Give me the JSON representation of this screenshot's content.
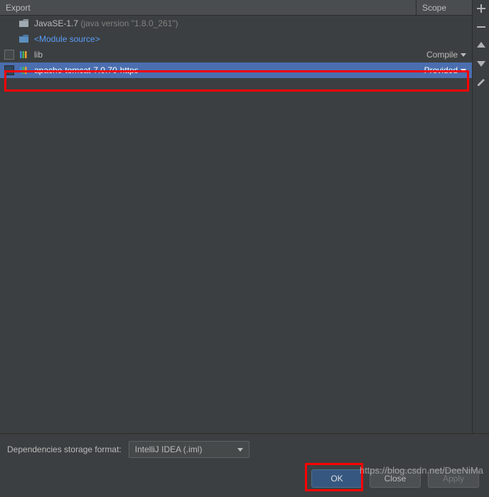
{
  "header": {
    "export": "Export",
    "scope": "Scope"
  },
  "rows": {
    "java": {
      "label": "JavaSE-1.7",
      "detail": " (java version \"1.8.0_261\")"
    },
    "module": {
      "label": "<Module source>"
    },
    "lib": {
      "label": "lib",
      "scope": "Compile"
    },
    "tomcat": {
      "label": "apache-tomcat-7.0.70-https",
      "scope": "Provided"
    }
  },
  "sidebar": {
    "add": "+",
    "remove": "−",
    "up": "▲",
    "down": "▼",
    "edit": "✎"
  },
  "storage": {
    "label": "Dependencies storage format:",
    "value": "IntelliJ IDEA (.iml)"
  },
  "buttons": {
    "ok": "OK",
    "close": "Close",
    "apply": "Apply"
  },
  "watermark": "https://blog.csdn.net/DeeNiMa"
}
